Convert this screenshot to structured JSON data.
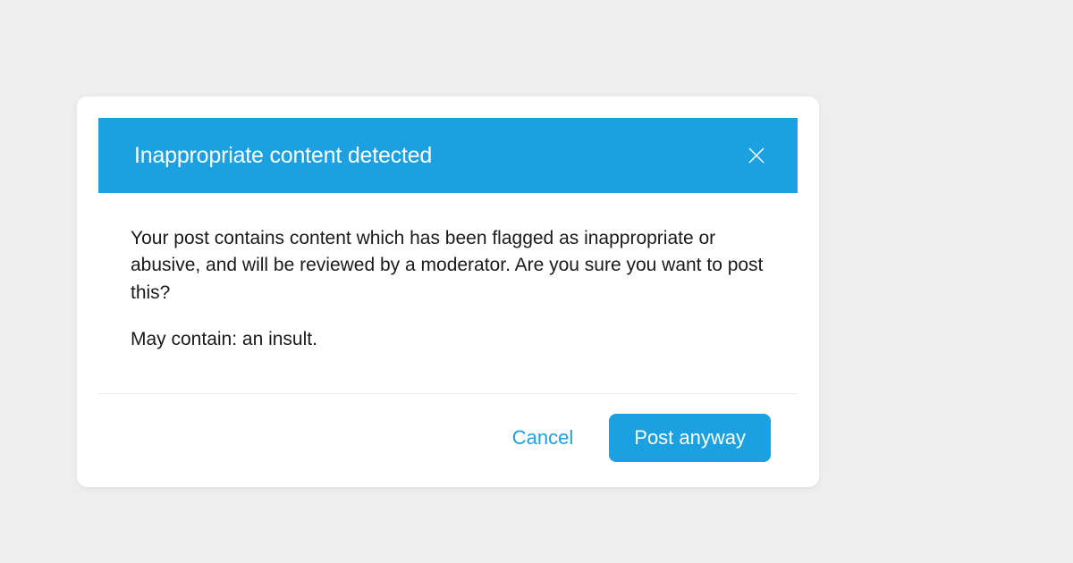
{
  "dialog": {
    "title": "Inappropriate content detected",
    "body_text": "Your post contains content which has been flagged as inappropriate or abusive, and will be reviewed by a moderator. Are you sure you want to post this?",
    "detail_text": "May contain: an insult.",
    "cancel_label": "Cancel",
    "confirm_label": "Post anyway"
  }
}
